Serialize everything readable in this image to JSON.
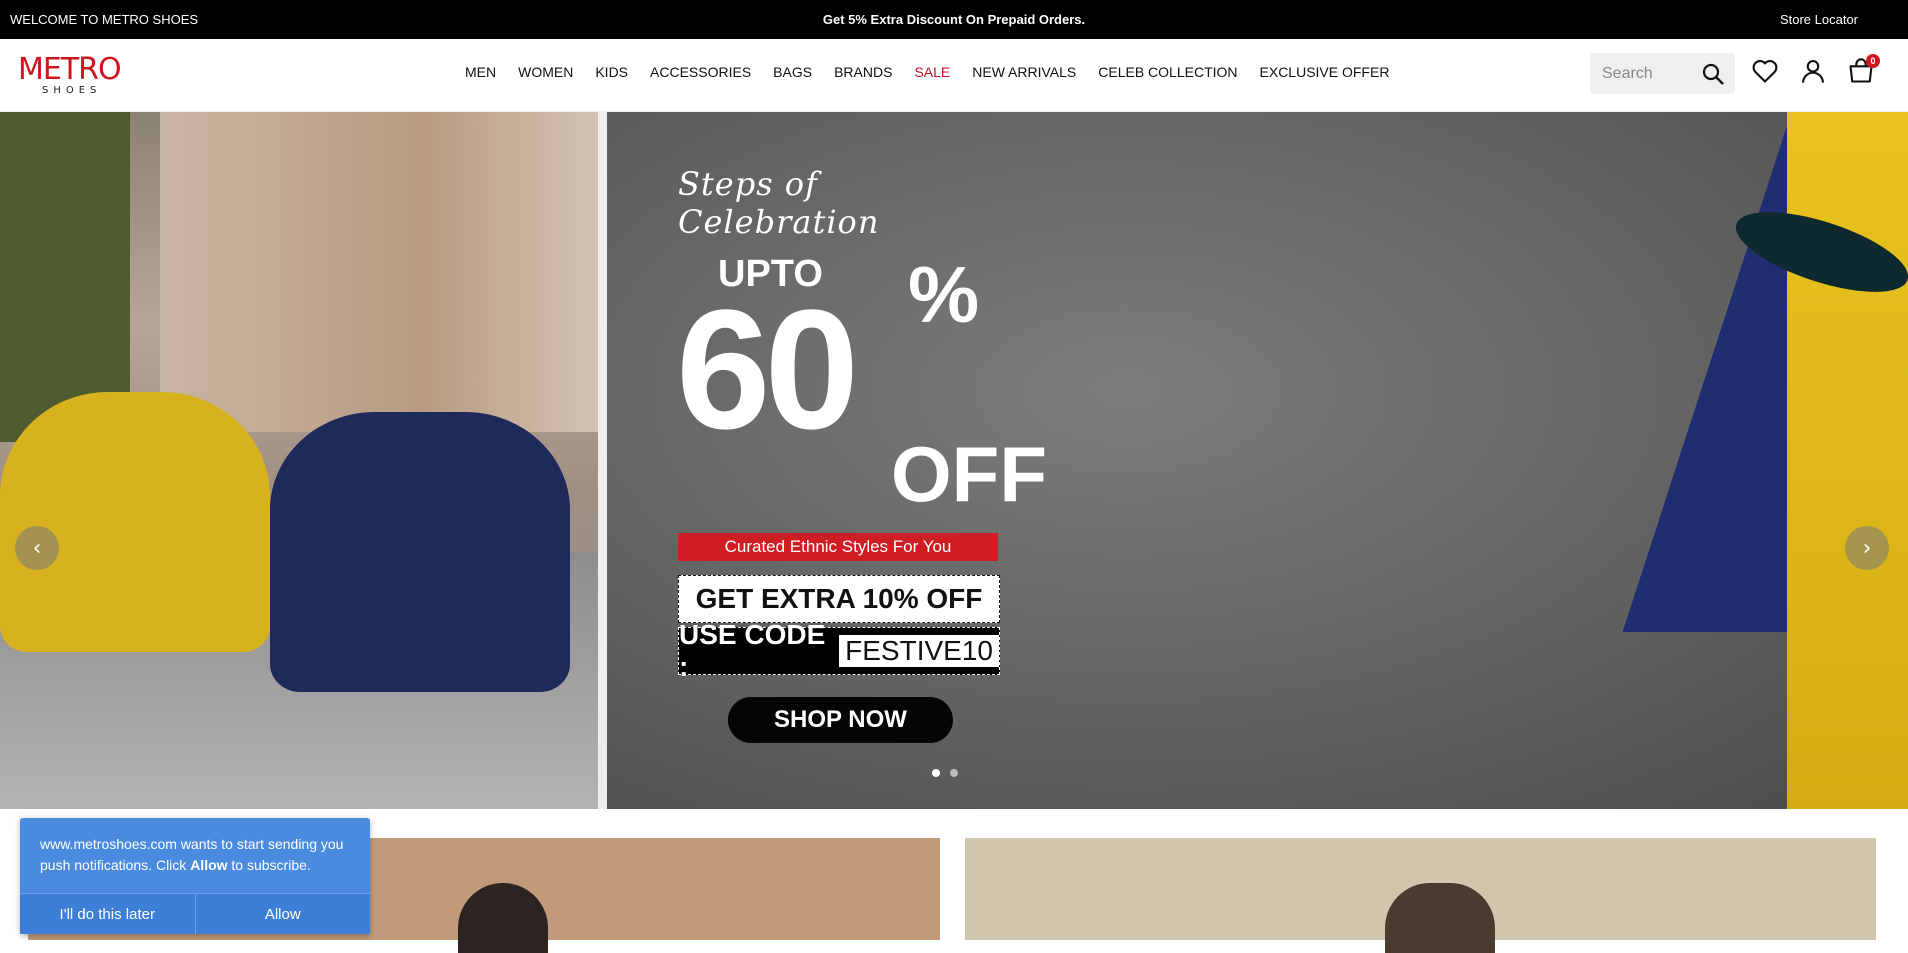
{
  "topbar": {
    "welcome": "WELCOME TO METRO SHOES",
    "promo": "Get 5% Extra Discount On Prepaid Orders.",
    "store_locator": "Store Locator"
  },
  "header": {
    "logo_main": "METRO",
    "logo_sub": "SHOES",
    "nav": [
      {
        "label": "MEN"
      },
      {
        "label": "WOMEN"
      },
      {
        "label": "KIDS"
      },
      {
        "label": "ACCESSORIES"
      },
      {
        "label": "BAGS"
      },
      {
        "label": "BRANDS"
      },
      {
        "label": "SALE"
      },
      {
        "label": "NEW ARRIVALS"
      },
      {
        "label": "CELEB COLLECTION"
      },
      {
        "label": "EXCLUSIVE OFFER"
      }
    ],
    "search_placeholder": "Search",
    "cart_count": "0"
  },
  "hero": {
    "script_title": "Steps of Celebration",
    "upto": "UPTO",
    "discount_number": "60",
    "percent": "%",
    "off": "OFF",
    "curated": "Curated Ethnic Styles For You",
    "extra_offer": "GET EXTRA 10% OFF",
    "use_code_label": "USE CODE :",
    "code": "FESTIVE10",
    "cta": "SHOP NOW",
    "active_slide": 1,
    "total_slides": 2
  },
  "notification": {
    "message_prefix": "www.metroshoes.com wants to start sending you push notifications. Click ",
    "message_bold": "Allow",
    "message_suffix": " to subscribe.",
    "later_label": "I'll do this later",
    "allow_label": "Allow"
  },
  "colors": {
    "brand_red": "#d0141e",
    "sale_red": "#c8102e",
    "topbar_bg": "#000000",
    "notify_blue": "#4a8be0"
  },
  "icons": [
    "search-icon",
    "heart-icon",
    "user-icon",
    "cart-icon",
    "chevron-left-icon",
    "chevron-right-icon"
  ]
}
